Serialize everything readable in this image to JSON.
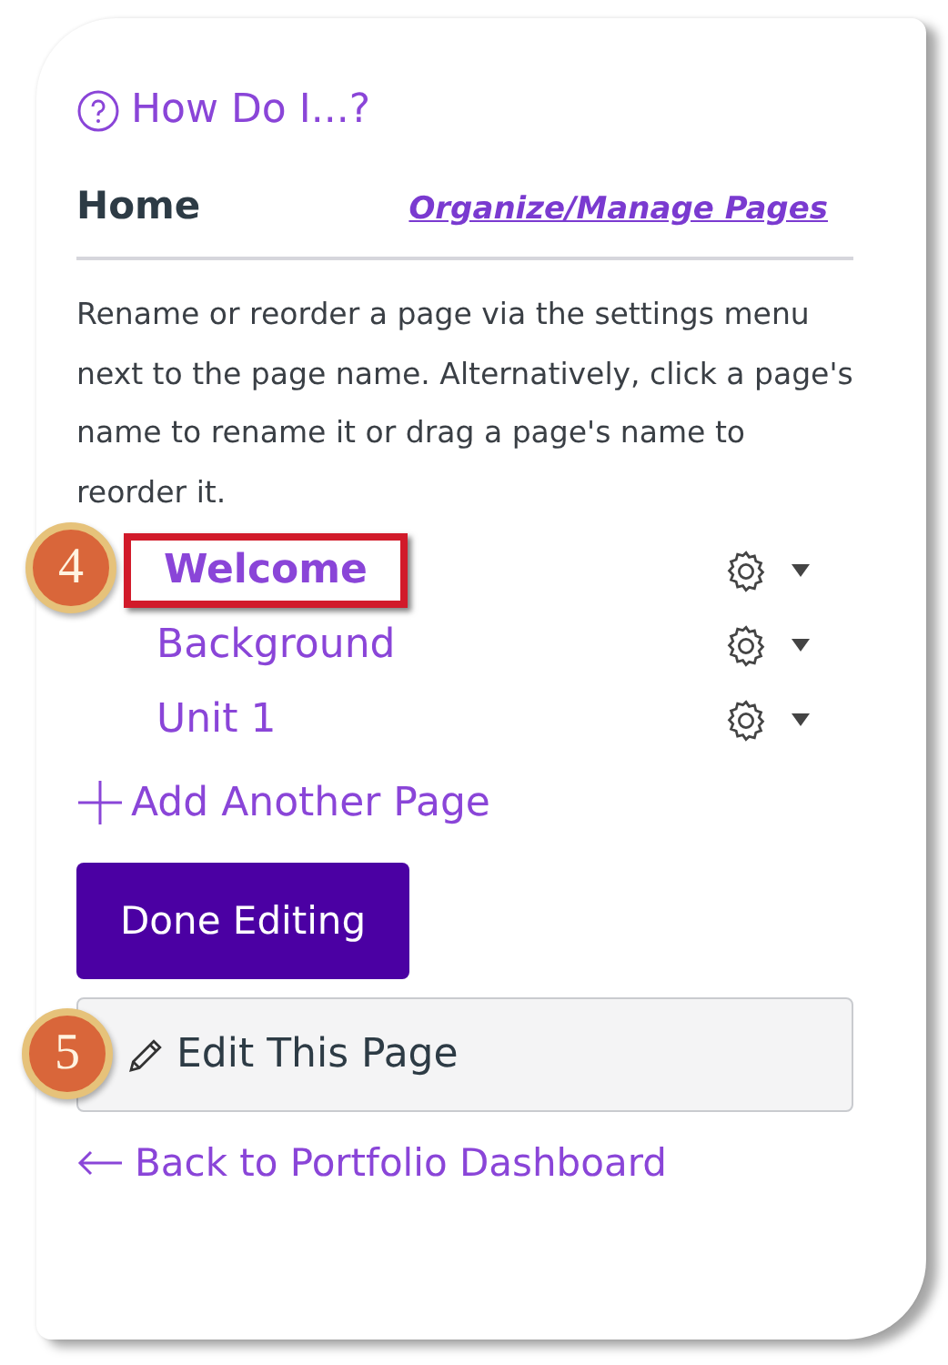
{
  "help_link": "How Do I...?",
  "header": {
    "title": "Home",
    "link": "Organize/Manage Pages"
  },
  "instructions": "Rename or reorder a page via the settings menu next to the page name. Alternatively, click a page's name to rename it or drag a page's name to reorder it.",
  "pages": [
    {
      "name": "Welcome",
      "current": true,
      "highlighted": true,
      "callout": "4"
    },
    {
      "name": "Background",
      "current": false,
      "highlighted": false
    },
    {
      "name": "Unit 1",
      "current": false,
      "highlighted": false
    }
  ],
  "add_page": "Add Another Page",
  "done_button": "Done Editing",
  "edit_button": {
    "label": "Edit This Page",
    "callout": "5"
  },
  "back_link": "Back to Portfolio Dashboard"
}
